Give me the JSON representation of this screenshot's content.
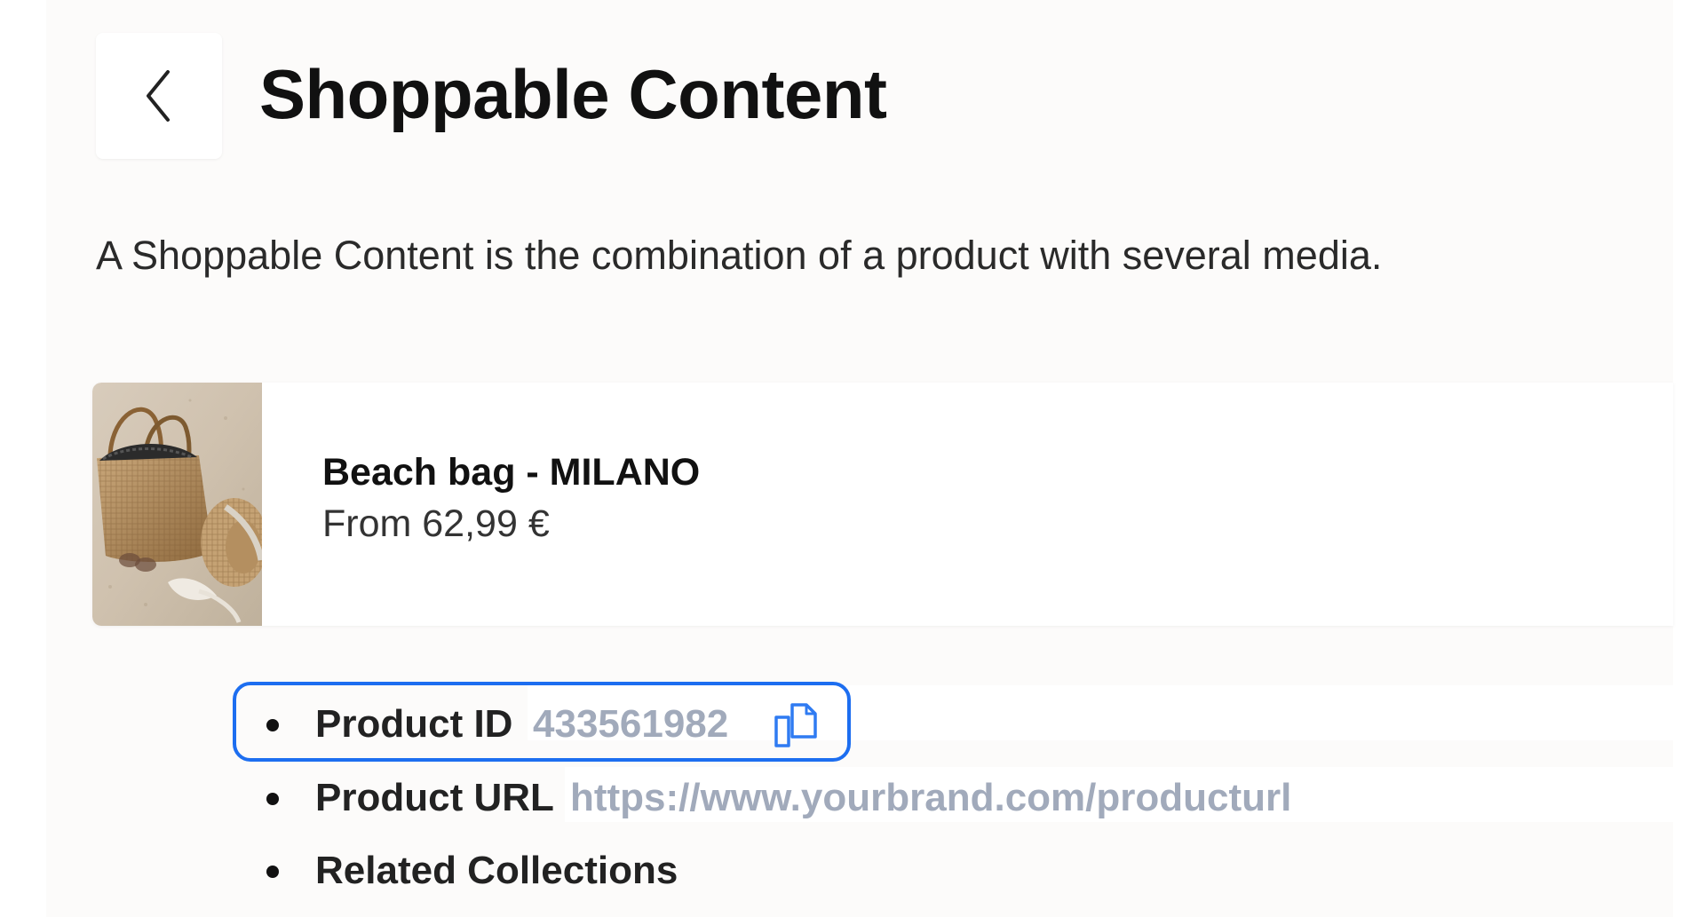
{
  "header": {
    "title": "Shoppable Content",
    "back_icon": "chevron-left-icon"
  },
  "description": "A Shoppable Content is the combination of a product with several media.",
  "product": {
    "name": "Beach bag - MILANO",
    "price": "From 62,99 €",
    "image": "beach-bag-photo"
  },
  "details": {
    "product_id_label": "Product ID",
    "product_id_value": "433561982",
    "product_url_label": "Product URL",
    "product_url_value": "https://www.yourbrand.com/producturl",
    "related_collections_label": "Related Collections",
    "copy_icon": "copy-icon"
  },
  "colors": {
    "highlight": "#1d6ef0",
    "muted_value": "#a1aabb",
    "panel_bg": "#fcfbfa"
  }
}
